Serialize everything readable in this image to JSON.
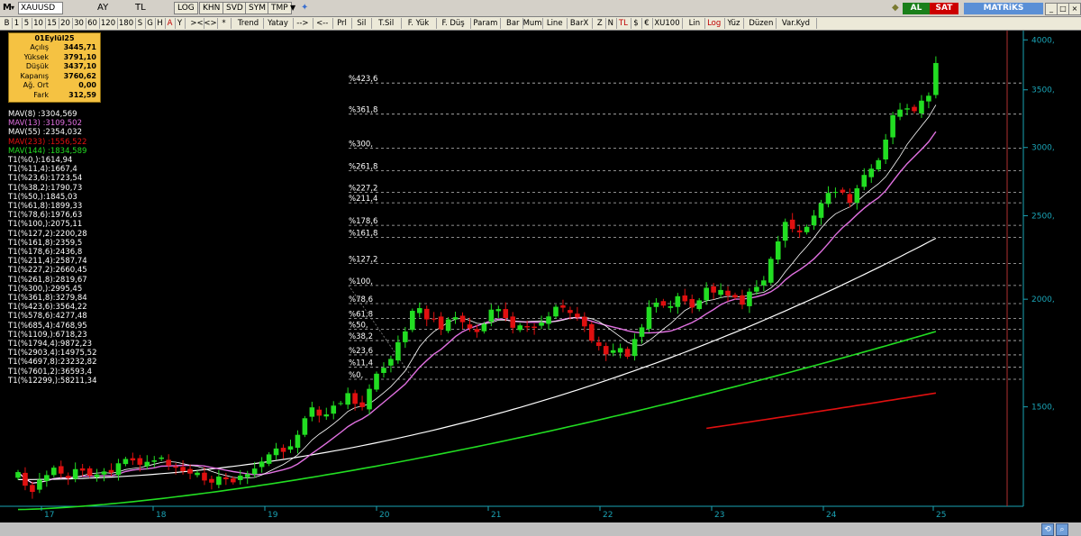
{
  "window": {
    "symbol": "XAUUSD",
    "menu_m": "M",
    "tabs": [
      "AY",
      "TL",
      "LOG",
      "KHN",
      "SVD",
      "SYM",
      "TMP"
    ],
    "al_label": "AL",
    "sat_label": "SAT",
    "brand": "MATRiKS"
  },
  "toolbar": {
    "periods": [
      "B",
      "1",
      "5",
      "10",
      "15",
      "20",
      "30",
      "60",
      "120",
      "180",
      "S",
      "G",
      "H",
      "A",
      "Y"
    ],
    "nav": [
      "><",
      "<>",
      "*"
    ],
    "tools": [
      "Trend",
      "Yatay",
      "-->",
      "<--",
      "Prl",
      "Sil",
      "T.Sil",
      "F. Yük",
      "F. Düş",
      "Param",
      "Bar",
      "Mum",
      "Line",
      "BarX",
      "Z",
      "N",
      "TL",
      "$",
      "€",
      "XU100",
      "Lin",
      "Log",
      "Yüz",
      "Düzen",
      "Var.Kyd"
    ]
  },
  "infobox": {
    "title": "01Eylül25",
    "rows": [
      {
        "label": "Açılış",
        "value": "3445,71"
      },
      {
        "label": "Yüksek",
        "value": "3791,10"
      },
      {
        "label": "Düşük",
        "value": "3437,10"
      },
      {
        "label": "Kapanış",
        "value": "3760,62"
      },
      {
        "label": "Ağ. Ort",
        "value": "0,00"
      },
      {
        "label": "Fark",
        "value": "312,59"
      }
    ]
  },
  "legend": [
    {
      "text": "MAV(8)      :3304,569",
      "color": "#ffffff"
    },
    {
      "text": "MAV(13)    :3109,502",
      "color": "#e070e0"
    },
    {
      "text": "MAV(55)    :2354,032",
      "color": "#ffffff"
    },
    {
      "text": "MAV(233)  :1556,522",
      "color": "#e01010"
    },
    {
      "text": "MAV(144)  :1834,589",
      "color": "#22dd22"
    },
    {
      "text": "T1(%0,):1614,94",
      "color": "#ffffff"
    },
    {
      "text": "T1(%11,4):1667,4",
      "color": "#ffffff"
    },
    {
      "text": "T1(%23,6):1723,54",
      "color": "#ffffff"
    },
    {
      "text": "T1(%38,2):1790,73",
      "color": "#ffffff"
    },
    {
      "text": "T1(%50,):1845,03",
      "color": "#ffffff"
    },
    {
      "text": "T1(%61,8):1899,33",
      "color": "#ffffff"
    },
    {
      "text": "T1(%78,6):1976,63",
      "color": "#ffffff"
    },
    {
      "text": "T1(%100,):2075,11",
      "color": "#ffffff"
    },
    {
      "text": "T1(%127,2):2200,28",
      "color": "#ffffff"
    },
    {
      "text": "T1(%161,8):2359,5",
      "color": "#ffffff"
    },
    {
      "text": "T1(%178,6):2436,8",
      "color": "#ffffff"
    },
    {
      "text": "T1(%211,4):2587,74",
      "color": "#ffffff"
    },
    {
      "text": "T1(%227,2):2660,45",
      "color": "#ffffff"
    },
    {
      "text": "T1(%261,8):2819,67",
      "color": "#ffffff"
    },
    {
      "text": "T1(%300,):2995,45",
      "color": "#ffffff"
    },
    {
      "text": "T1(%361,8):3279,84",
      "color": "#ffffff"
    },
    {
      "text": "T1(%423,6):3564,22",
      "color": "#ffffff"
    },
    {
      "text": "T1(%578,6):4277,48",
      "color": "#ffffff"
    },
    {
      "text": "T1(%685,4):4768,95",
      "color": "#ffffff"
    },
    {
      "text": "T1(%1109,):6718,23",
      "color": "#ffffff"
    },
    {
      "text": "T1(%1794,4):9872,23",
      "color": "#ffffff"
    },
    {
      "text": "T1(%2903,4):14975,52",
      "color": "#ffffff"
    },
    {
      "text": "T1(%4697,8):23232,82",
      "color": "#ffffff"
    },
    {
      "text": "T1(%7601,2):36593,4",
      "color": "#ffffff"
    },
    {
      "text": "T1(%12299,):58211,34",
      "color": "#ffffff"
    }
  ],
  "chart_data": {
    "type": "candlestick",
    "scale": "log",
    "ylim": [
      1150,
      4100
    ],
    "yticks": [
      "4000,",
      "3500,",
      "3000,",
      "2500,",
      "2000,",
      "1500,"
    ],
    "ytick_values": [
      4000,
      3500,
      3000,
      2500,
      2000,
      1500
    ],
    "x_labels": [
      "17",
      "18",
      "19",
      "20",
      "21",
      "22",
      "23",
      "24",
      "25"
    ],
    "colors": {
      "up": "#22dd22",
      "down": "#e01010",
      "ma8": "#ffffff",
      "ma13": "#e070e0",
      "ma55": "#ffffff",
      "ma144": "#22dd22",
      "ma233": "#e01010"
    },
    "fib_levels": [
      {
        "label": "%0,",
        "value": 1614.94
      },
      {
        "label": "%11,4",
        "value": 1667.4
      },
      {
        "label": "%23,6",
        "value": 1723.54
      },
      {
        "label": "%38,2",
        "value": 1790.73
      },
      {
        "label": "%50,",
        "value": 1845.03
      },
      {
        "label": "%61,8",
        "value": 1899.33
      },
      {
        "label": "%78,6",
        "value": 1976.63
      },
      {
        "label": "%100,",
        "value": 2075.11
      },
      {
        "label": "%127,2",
        "value": 2200.28
      },
      {
        "label": "%161,8",
        "value": 2359.5
      },
      {
        "label": "%178,6",
        "value": 2436.8
      },
      {
        "label": "%211,4",
        "value": 2587.74
      },
      {
        "label": "%227,2",
        "value": 2660.45
      },
      {
        "label": "%261,8",
        "value": 2819.67
      },
      {
        "label": "%300,",
        "value": 2995.45
      },
      {
        "label": "%361,8",
        "value": 3279.84
      },
      {
        "label": "%423,6",
        "value": 3564.22
      }
    ],
    "closes": [
      1260,
      1215,
      1195,
      1235,
      1250,
      1275,
      1255,
      1240,
      1270,
      1265,
      1248,
      1252,
      1262,
      1258,
      1290,
      1305,
      1300,
      1285,
      1295,
      1300,
      1310,
      1282,
      1275,
      1263,
      1255,
      1258,
      1232,
      1225,
      1245,
      1236,
      1226,
      1248,
      1253,
      1272,
      1296,
      1321,
      1342,
      1330,
      1350,
      1392,
      1455,
      1498,
      1465,
      1470,
      1505,
      1515,
      1556,
      1512,
      1499,
      1574,
      1639,
      1665,
      1705,
      1783,
      1835,
      1939,
      1953,
      1895,
      1898,
      1845,
      1895,
      1906,
      1881,
      1850,
      1832,
      1872,
      1945,
      1948,
      1902,
      1853,
      1865,
      1855,
      1852,
      1880,
      1910,
      1960,
      1955,
      1928,
      1905,
      1860,
      1790,
      1765,
      1726,
      1745,
      1755,
      1715,
      1798,
      1855,
      1959,
      1982,
      1966,
      1963,
      2016,
      1989,
      1956,
      1994,
      2062,
      2036,
      2050,
      2019,
      2009,
      1971,
      2041,
      2067,
      2103,
      2228,
      2334,
      2459,
      2413,
      2392,
      2427,
      2501,
      2585,
      2657,
      2664,
      2660,
      2588,
      2690,
      2788,
      2835,
      2900,
      3064,
      3270,
      3320,
      3331,
      3306,
      3400,
      3445,
      3760
    ]
  },
  "bottom": {
    "icon1": "sync-icon",
    "icon2": "zoom-icon"
  }
}
